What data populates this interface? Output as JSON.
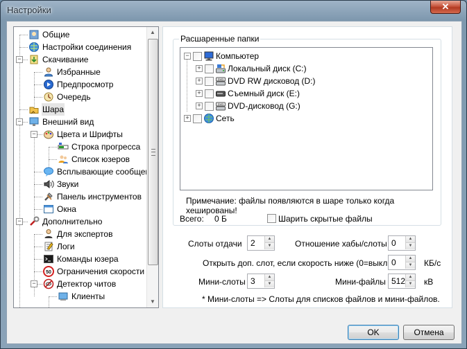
{
  "window": {
    "title": "Настройки",
    "close_glyph": "✕"
  },
  "tree": {
    "items": [
      {
        "label": "Общие",
        "icon": "general-icon"
      },
      {
        "label": "Настройки соединения",
        "icon": "globe-icon"
      },
      {
        "label": "Скачивание",
        "icon": "download-icon"
      },
      {
        "label": "Избранные",
        "icon": "user-icon"
      },
      {
        "label": "Предпросмотр",
        "icon": "preview-icon"
      },
      {
        "label": "Очередь",
        "icon": "queue-icon"
      },
      {
        "label": "Шара",
        "icon": "share-icon"
      },
      {
        "label": "Внешний вид",
        "icon": "appearance-icon"
      },
      {
        "label": "Цвета и Шрифты",
        "icon": "palette-icon"
      },
      {
        "label": "Строка прогресса",
        "icon": "progress-icon"
      },
      {
        "label": "Список юзеров",
        "icon": "userlist-icon"
      },
      {
        "label": "Всплывающие сообщения",
        "icon": "popup-icon"
      },
      {
        "label": "Звуки",
        "icon": "sound-icon"
      },
      {
        "label": "Панель инструментов",
        "icon": "toolbar-icon"
      },
      {
        "label": "Окна",
        "icon": "windows-icon"
      },
      {
        "label": "Дополнительно",
        "icon": "advanced-icon"
      },
      {
        "label": "Для экспертов",
        "icon": "expert-icon"
      },
      {
        "label": "Логи",
        "icon": "logs-icon"
      },
      {
        "label": "Команды юзера",
        "icon": "commands-icon"
      },
      {
        "label": "Ограничения скорости",
        "icon": "speed-limit-icon"
      },
      {
        "label": "Детектор читов",
        "icon": "cheat-detector-icon"
      },
      {
        "label": "Клиенты",
        "icon": "clients-icon"
      }
    ]
  },
  "shared": {
    "group_title": "Расшаренные папки",
    "folders": [
      {
        "label": "Компьютер",
        "icon": "computer-icon"
      },
      {
        "label": "Локальный диск (C:)",
        "icon": "hdd-icon"
      },
      {
        "label": "DVD RW дисковод (D:)",
        "icon": "dvd-icon"
      },
      {
        "label": "Съемный диск (E:)",
        "icon": "removable-icon"
      },
      {
        "label": "DVD-дисковод (G:)",
        "icon": "dvd-icon"
      },
      {
        "label": "Сеть",
        "icon": "network-icon"
      }
    ],
    "note": "Примечание: файлы появляются в шаре только когда хешированы!",
    "total_label": "Всего:",
    "total_value": "0 Б",
    "share_hidden_label": "Шарить скрытые файлы"
  },
  "settings": {
    "upload_slots_label": "Слоты отдачи",
    "upload_slots_value": "2",
    "hub_slot_ratio_label": "Отношение хабы/слоты",
    "hub_slot_ratio_value": "0",
    "extra_slot_label": "Открыть доп. слот, если скорость ниже (0=выкл.)",
    "extra_slot_value": "0",
    "extra_slot_unit": "КБ/с",
    "mini_slots_label": "Мини-слоты",
    "mini_slots_value": "3",
    "mini_files_label": "Мини-файлы",
    "mini_files_value": "512",
    "mini_files_unit": "кВ",
    "mini_note": "* Мини-слоты => Слоты для списков файлов и мини-файлов."
  },
  "buttons": {
    "ok": "OK",
    "cancel": "Отмена"
  }
}
